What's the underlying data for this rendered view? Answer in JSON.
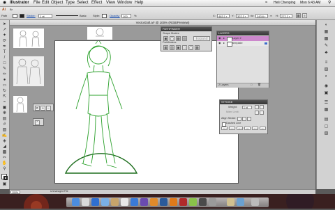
{
  "menubar": {
    "app": "Illustrator",
    "menus": [
      "File",
      "Edit",
      "Object",
      "Type",
      "Select",
      "Effect",
      "View",
      "Window",
      "Help"
    ],
    "user": "Heli Chenping",
    "clock": "Mon 6:43 AM"
  },
  "controlbar": {
    "label": "Path",
    "stroke_label": "Stroke:",
    "stroke_value": "1 pt",
    "brush_label": "Basic",
    "style_label": "Style:",
    "opacity_label": "Opacity:",
    "opacity_value": "100",
    "x_label": "X:",
    "x_value": "483.1 r",
    "y_label": "Y:",
    "y_value": "322.3 r",
    "w_label": "W:",
    "w_value": "243.6 r",
    "h_label": "H:",
    "h_value": "272.2 r",
    "colors": {
      "fill": "#ffffff",
      "stroke": "#222222"
    }
  },
  "document": {
    "title": "VectorDoll.ai* @ 100% (RGB/Preview)"
  },
  "pathfinder": {
    "title": "PATHFINDER",
    "shape_modes_label": "Shape Modes:",
    "pathfinders_label": "Pathfinders:",
    "expand_label": "Expand"
  },
  "layers": {
    "title": "LAYERS",
    "items": [
      {
        "name": "Layer 2",
        "color": "#cc66cc"
      },
      {
        "name": "template",
        "color": "#3c6ecc"
      }
    ],
    "footer": "2 Layers"
  },
  "stroke_panel": {
    "title": "STROKE",
    "weight_label": "Weight:",
    "weight_value": "1 pt",
    "miter_label": "Miter Limit:",
    "align_label": "Align Stroke:",
    "dashed_label": "Dashed Line",
    "dash_labels": [
      "dash",
      "gap",
      "dash",
      "gap",
      "dash",
      "gap"
    ]
  },
  "statusbar": {
    "zoom": "100%",
    "status": "Unmanaged File"
  },
  "figure_colors": {
    "outline": "#2aa02a",
    "mound": "#1e6e1e"
  }
}
